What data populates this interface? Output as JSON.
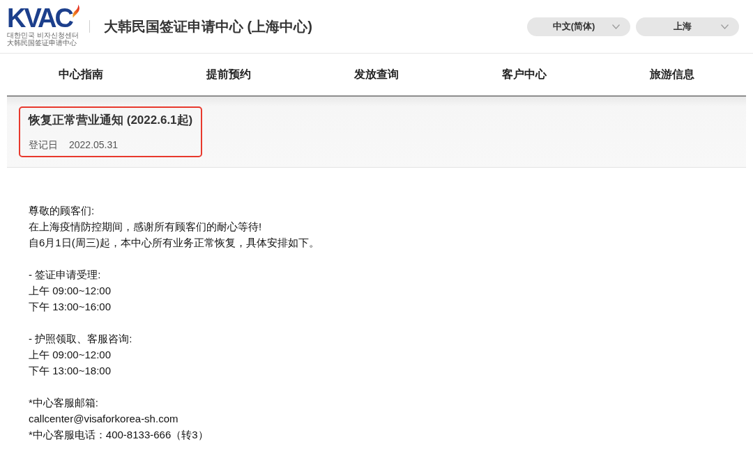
{
  "header": {
    "logo": {
      "wordmark": "KVAC",
      "line_1": "대한민국 비자신청센터",
      "line_2": "大韩民国签证申请中心"
    },
    "site_title": "大韩民国签证申请中心 (上海中心)",
    "selectors": [
      {
        "value": "中文(简体)"
      },
      {
        "value": "上海"
      }
    ]
  },
  "nav": {
    "items": [
      {
        "label": "中心指南"
      },
      {
        "label": "提前预约"
      },
      {
        "label": "发放查询"
      },
      {
        "label": "客户中心"
      },
      {
        "label": "旅游信息"
      }
    ]
  },
  "notice": {
    "highlighted": true,
    "title": "恢复正常营业通知 (2022.6.1起)",
    "date_label": "登记日",
    "date": "2022.05.31",
    "body": [
      [
        "尊敬的顾客们:",
        "在上海疫情防控期间，感谢所有顾客们的耐心等待!",
        "自6月1日(周三)起，本中心所有业务正常恢复，具体安排如下。"
      ],
      [
        "- 签证申请受理:",
        "上午 09:00~12:00",
        "下午 13:00~16:00"
      ],
      [
        "- 护照领取、客服咨询:",
        "上午 09:00~12:00",
        "下午 13:00~18:00"
      ],
      [
        "*中心客服邮箱:",
        "callcenter@visaforkorea-sh.com",
        "*中心客服电话：400-8133-666（转3）"
      ]
    ]
  }
}
